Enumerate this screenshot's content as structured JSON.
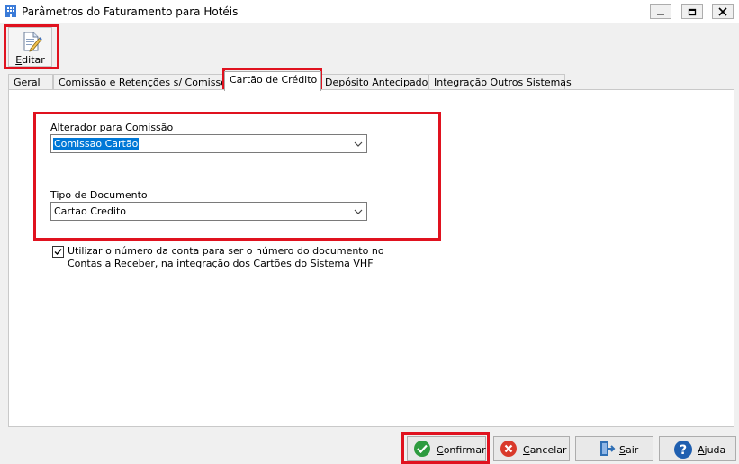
{
  "window": {
    "title": "Parâmetros do Faturamento para Hotéis",
    "minimize_glyph": "▭",
    "maximize_glyph": "□",
    "close_glyph": "✕"
  },
  "toolbar": {
    "edit": {
      "label_first": "E",
      "label_rest": "ditar",
      "icon": "edit-document-icon"
    }
  },
  "tabs": [
    {
      "label": "Geral"
    },
    {
      "label": "Comissão e Retenções s/ Comissões"
    },
    {
      "label": "Cartão de Crédito",
      "active": true
    },
    {
      "label": "Depósito Antecipado"
    },
    {
      "label": "Integração Outros Sistemas"
    }
  ],
  "form": {
    "alterador": {
      "label": "Alterador para Comissão",
      "value": "Comissao Cartão"
    },
    "tipo_documento": {
      "label": "Tipo de Documento",
      "value": "Cartao Credito"
    },
    "checkbox": {
      "checked": true,
      "label": "Utilizar o número da conta para ser o número do documento no Contas a Receber, na integração dos Cartões do Sistema VHF"
    }
  },
  "buttons": {
    "confirmar": {
      "first": "C",
      "rest": "onfirmar",
      "icon": "check-icon",
      "color": "#2e9b3f"
    },
    "cancelar": {
      "first": "C",
      "rest": "ancelar",
      "icon": "cancel-icon",
      "color": "#d93a2b"
    },
    "sair": {
      "first": "S",
      "rest": "air",
      "icon": "exit-door-icon",
      "color": "#2f6fb5"
    },
    "ajuda": {
      "first": "A",
      "rest": "juda",
      "icon": "help-icon",
      "color": "#1f5fb0"
    }
  },
  "colors": {
    "highlight": "#e0121f",
    "selection": "#0078d7"
  }
}
